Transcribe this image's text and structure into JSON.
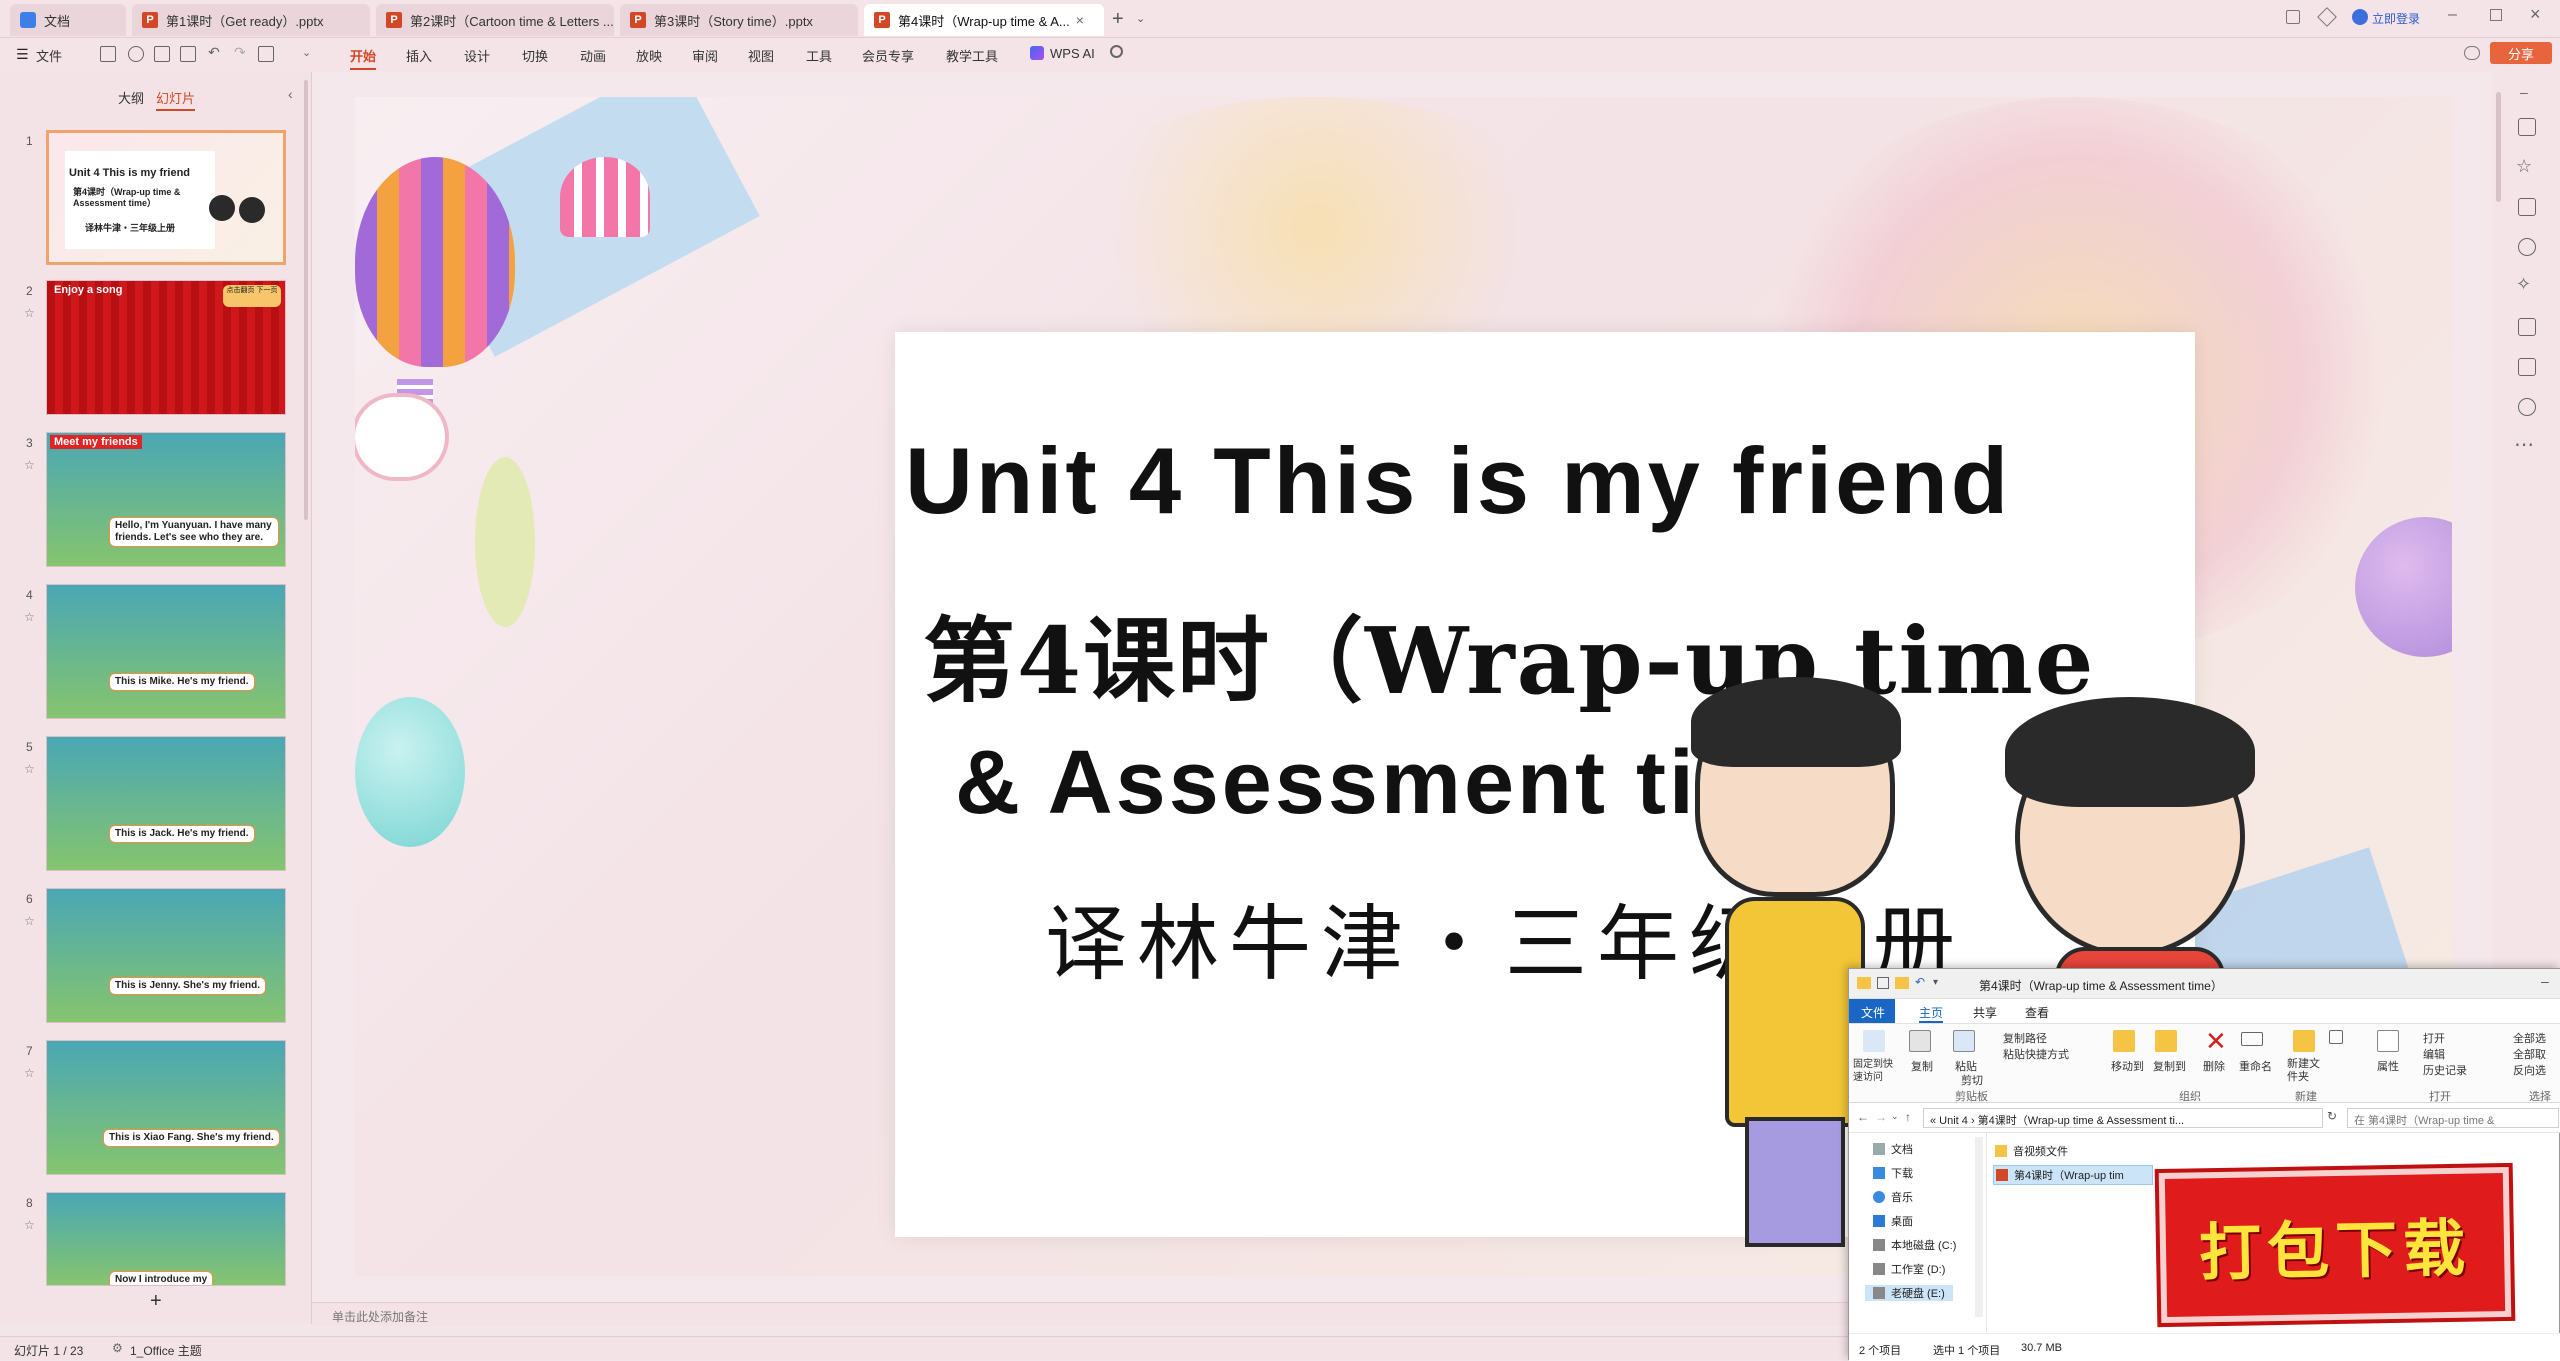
{
  "tabs": [
    {
      "label": "文档",
      "type": "home"
    },
    {
      "label": "第1课时（Get ready）.pptx",
      "type": "ppt"
    },
    {
      "label": "第2课时（Cartoon time & Letters ...",
      "type": "ppt"
    },
    {
      "label": "第3课时（Story time）.pptx",
      "type": "ppt"
    },
    {
      "label": "第4课时（Wrap-up time & A...",
      "type": "ppt",
      "active": true
    }
  ],
  "titlebar": {
    "login": "立即登录",
    "share": "分享"
  },
  "menu": {
    "file": "文件",
    "items": [
      "开始",
      "插入",
      "设计",
      "切换",
      "动画",
      "放映",
      "审阅",
      "视图",
      "工具",
      "会员专享",
      "教学工具",
      "WPS AI"
    ],
    "active": "开始"
  },
  "leftpanel": {
    "tab_outline": "大纲",
    "tab_slides": "幻灯片",
    "add_label": "+",
    "slides": [
      {
        "num": "1",
        "caption": "",
        "title": "Unit 4 This is my friend",
        "sub": "第4课时（Wrap-up time & Assessment time）",
        "pub": "译林牛津・三年级上册"
      },
      {
        "num": "2",
        "caption": "Enjoy a song",
        "bubble": "点击翻页 下一页"
      },
      {
        "num": "3",
        "caption": "Meet my friends",
        "bubble": "Hello, I'm Yuanyuan. I have many friends. Let's see who they are."
      },
      {
        "num": "4",
        "caption": "",
        "bubble": "This is Mike. He's my friend."
      },
      {
        "num": "5",
        "caption": "",
        "bubble": "This is Jack. He's my friend."
      },
      {
        "num": "6",
        "caption": "",
        "bubble": "This is Jenny. She's my friend."
      },
      {
        "num": "7",
        "caption": "",
        "bubble": "This is Xiao Fang. She's my friend."
      },
      {
        "num": "8",
        "caption": "",
        "bubble": "Now I introduce my"
      }
    ]
  },
  "slide": {
    "title": "Unit 4 This is my friend",
    "subtitle_line1": "第4课时（Wrap-up time",
    "subtitle_line2": "& Assessment time）",
    "publisher": "译林牛津・三年级上册"
  },
  "notes": {
    "placeholder": "单击此处添加备注"
  },
  "status": {
    "slide_count": "幻灯片 1 / 23",
    "theme": "1_Office 主题"
  },
  "explorer": {
    "title": "第4课时（Wrap-up time & Assessment time）",
    "tabs": [
      "文件",
      "主页",
      "共享",
      "查看"
    ],
    "ribbon": {
      "pin": "固定到快速访问",
      "copy": "复制",
      "paste": "粘贴",
      "copy_path": "复制路径",
      "paste_shortcut": "粘贴快捷方式",
      "cut": "剪切",
      "group_clipboard": "剪贴板",
      "move_to": "移动到",
      "copy_to": "复制到",
      "delete": "删除",
      "rename": "重命名",
      "group_organize": "组织",
      "new_folder": "新建文件夹",
      "group_new": "新建",
      "properties": "属性",
      "open": "打开",
      "edit": "编辑",
      "history": "历史记录",
      "group_open": "打开",
      "select_all": "全部选",
      "select_none": "全部取",
      "invert": "反向选",
      "group_select": "选择"
    },
    "address": "« Unit 4 › 第4课时（Wrap-up time & Assessment ti...",
    "search_placeholder": "在 第4课时（Wrap-up time &",
    "nav": [
      "文档",
      "下载",
      "音乐",
      "桌面",
      "本地磁盘 (C:)",
      "工作室 (D:)",
      "老硬盘 (E:)"
    ],
    "files": [
      "音视频文件",
      "第4课时（Wrap-up tim"
    ],
    "status": {
      "count": "2 个项目",
      "selected": "选中 1 个项目",
      "size": "30.7 MB"
    }
  },
  "download_button": "打包下载"
}
